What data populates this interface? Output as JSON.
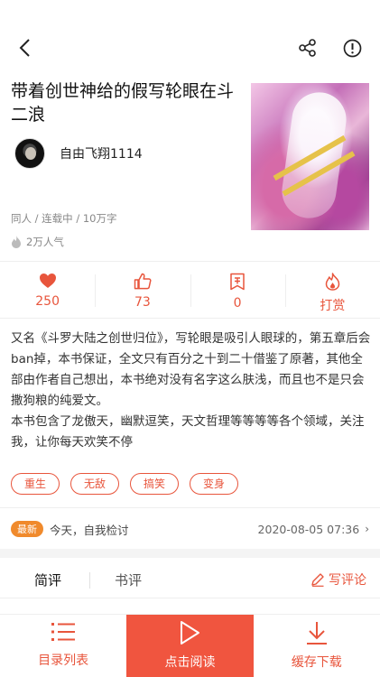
{
  "header": {
    "back_icon": "chevron-left-icon",
    "share_icon": "share-icon",
    "report_icon": "exclamation-circle-icon"
  },
  "book": {
    "title": "带着创世神给的假写轮眼在斗二浪",
    "author": "自由飞翔1114",
    "meta": "同人 / 连载中 / 10万字",
    "popularity": "2万人气"
  },
  "stats": [
    {
      "icon": "heart-icon",
      "value": "250"
    },
    {
      "icon": "thumbs-up-icon",
      "value": "73"
    },
    {
      "icon": "ticket-icon",
      "value": "0"
    },
    {
      "icon": "flame-icon",
      "value": "打赏"
    }
  ],
  "synopsis": {
    "para1": "又名《斗罗大陆之创世归位》，写轮眼是吸引人眼球的，第五章后会ban掉，本书保证，全文只有百分之十到二十借鉴了原著，其他全部由作者自己想出，本书绝对没有名字这么肤浅，而且也不是只会撒狗粮的纯爱文。",
    "para2": "本书包含了龙傲天，幽默逗笑，天文哲理等等等等各个领域，关注我，让你每天欢笑不停"
  },
  "tags": [
    "重生",
    "无敌",
    "搞笑",
    "变身"
  ],
  "latest": {
    "badge": "最新",
    "chapter": "今天，自我检讨",
    "date": "2020-08-05 07:36",
    "arrow": "›"
  },
  "reviews": {
    "tab_short": "简评",
    "tab_book": "书评",
    "write_label": "写评论"
  },
  "bottom_bar": {
    "catalog": "目录列表",
    "read": "点击阅读",
    "download": "缓存下载"
  },
  "colors": {
    "accent": "#e8553c",
    "read_button": "#f0553f",
    "latest_badge": "#f08a2c"
  }
}
